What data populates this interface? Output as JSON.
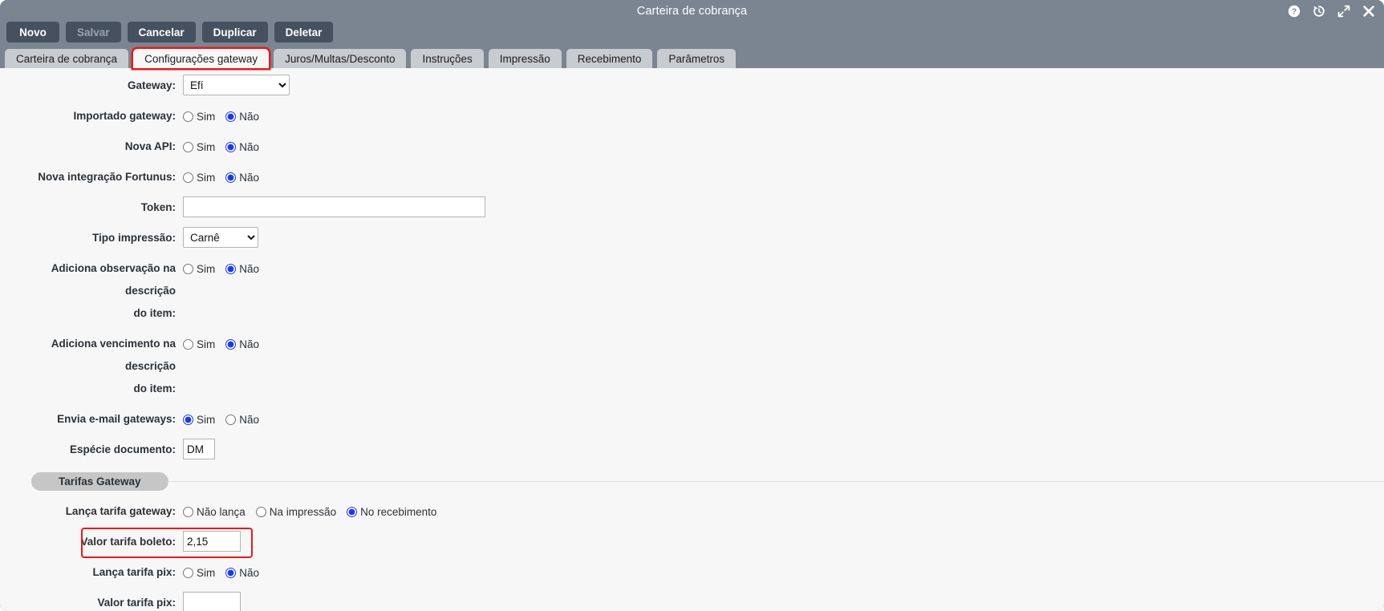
{
  "window": {
    "title": "Carteira de cobrança",
    "icons": [
      {
        "name": "help-icon",
        "glyph": "?"
      },
      {
        "name": "history-icon",
        "glyph": "history"
      },
      {
        "name": "expand-icon",
        "glyph": "expand"
      },
      {
        "name": "close-icon",
        "glyph": "close"
      }
    ]
  },
  "toolbar": {
    "buttons": [
      {
        "label": "Novo",
        "disabled": false
      },
      {
        "label": "Salvar",
        "disabled": true
      },
      {
        "label": "Cancelar",
        "disabled": false
      },
      {
        "label": "Duplicar",
        "disabled": false
      },
      {
        "label": "Deletar",
        "disabled": false
      }
    ]
  },
  "tabs": [
    {
      "label": "Carteira de cobrança",
      "active": false
    },
    {
      "label": "Configurações gateway",
      "active": true
    },
    {
      "label": "Juros/Multas/Desconto",
      "active": false
    },
    {
      "label": "Instruções",
      "active": false
    },
    {
      "label": "Impressão",
      "active": false
    },
    {
      "label": "Recebimento",
      "active": false
    },
    {
      "label": "Parâmetros",
      "active": false
    }
  ],
  "form": {
    "gateway": {
      "label": "Gateway:",
      "value": "Efí",
      "options": [
        "Efí"
      ]
    },
    "importado_gateway": {
      "label": "Importado gateway:",
      "options": [
        "Sim",
        "Não"
      ],
      "selected": "Não"
    },
    "nova_api": {
      "label": "Nova API:",
      "options": [
        "Sim",
        "Não"
      ],
      "selected": "Não"
    },
    "nova_integracao_fortunus": {
      "label": "Nova integração Fortunus:",
      "options": [
        "Sim",
        "Não"
      ],
      "selected": "Não"
    },
    "token": {
      "label": "Token:",
      "value": "",
      "placeholder": ""
    },
    "tipo_impressao": {
      "label": "Tipo impressão:",
      "value": "Carnê",
      "options": [
        "Carnê"
      ]
    },
    "adiciona_observacao": {
      "label_line1": "Adiciona observação na descrição",
      "label_line2": "do item:",
      "options": [
        "Sim",
        "Não"
      ],
      "selected": "Não"
    },
    "adiciona_vencimento": {
      "label_line1": "Adiciona vencimento na descrição",
      "label_line2": "do item:",
      "options": [
        "Sim",
        "Não"
      ],
      "selected": "Não"
    },
    "envia_email_gateways": {
      "label": "Envia e-mail gateways:",
      "options": [
        "Sim",
        "Não"
      ],
      "selected": "Sim"
    },
    "especie_documento": {
      "label": "Espécie documento:",
      "value": "DM"
    }
  },
  "tarifas_section": {
    "title": "Tarifas Gateway",
    "lanca_tarifa_gateway": {
      "label": "Lança tarifa gateway:",
      "options": [
        "Não lança",
        "Na impressão",
        "No recebimento"
      ],
      "selected": "No recebimento"
    },
    "valor_tarifa_boleto": {
      "label": "Valor tarifa boleto:",
      "value": "2,15",
      "highlighted": true
    },
    "lanca_tarifa_pix": {
      "label": "Lança tarifa pix:",
      "options": [
        "Sim",
        "Não"
      ],
      "selected": "Não"
    },
    "valor_tarifa_pix": {
      "label": "Valor tarifa pix:",
      "value": ""
    }
  },
  "colors": {
    "chrome": "#7b8592",
    "button": "#465160",
    "tab_inactive": "#c8cbcf",
    "content_bg": "#f7f7f7",
    "highlight": "#e81a1a",
    "radio_accent": "#1a39e8"
  }
}
